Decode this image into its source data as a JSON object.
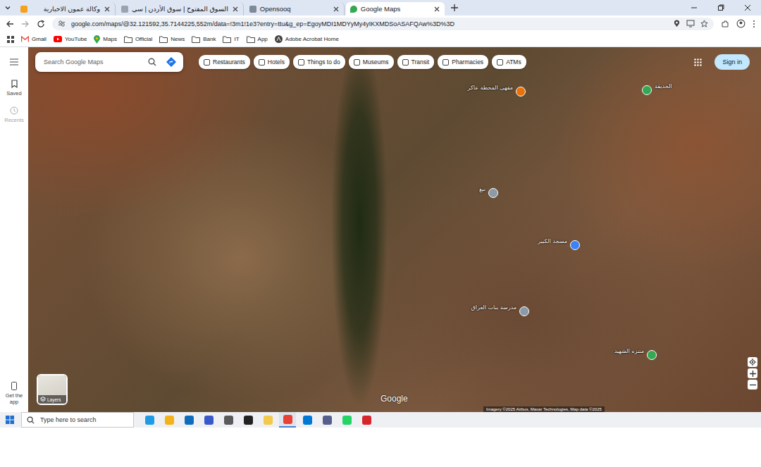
{
  "browser": {
    "tabs": [
      {
        "label": "وكالة عمون الاخبارية",
        "selected": false
      },
      {
        "label": "السوق المفتوح | سوق الأردن | سي",
        "selected": false
      },
      {
        "label": "Opensooq",
        "selected": false
      },
      {
        "label": "Google Maps",
        "selected": true
      }
    ],
    "url": "google.com/maps/@32.121592,35.7144225,552m/data=!3m1!1e3?entry=ttu&g_ep=EgoyMDI1MDYyMy4yIKXMDSoASAFQAw%3D%3D",
    "bookmarks": [
      {
        "label": "Gmail",
        "kind": "gmail"
      },
      {
        "label": "YouTube",
        "kind": "youtube"
      },
      {
        "label": "Maps",
        "kind": "maps"
      },
      {
        "label": "Official",
        "kind": "folder"
      },
      {
        "label": "News",
        "kind": "folder"
      },
      {
        "label": "Bank",
        "kind": "folder"
      },
      {
        "label": "IT",
        "kind": "folder"
      },
      {
        "label": "App",
        "kind": "folder"
      },
      {
        "label": "Adobe Acrobat Home",
        "kind": "adobe"
      }
    ]
  },
  "maps": {
    "rail": [
      {
        "label": "Saved",
        "disabled": false
      },
      {
        "label": "Recents",
        "disabled": true
      }
    ],
    "get_app": "Get the app",
    "search": {
      "placeholder": "Search Google Maps"
    },
    "chips": [
      "Restaurants",
      "Hotels",
      "Things to do",
      "Museums",
      "Transit",
      "Pharmacies",
      "ATMs"
    ],
    "sign_in": "Sign in",
    "layers": "Layers",
    "logo": "Google",
    "attribution": "Imagery ©2025 Airbus, Maxar Technologies, Map data ©2025",
    "markers": [
      {
        "label": "مقهى المحطة عاكر",
        "color": "#e8710a"
      },
      {
        "label": "نبع",
        "color": "#8a9aa8"
      },
      {
        "label": "مسجد الكبير",
        "color": "#3b82f6"
      },
      {
        "label": "مدرسة بنات العراق",
        "color": "#8a9aa8"
      },
      {
        "label": "متنزه الشهيد",
        "color": "#34a853"
      },
      {
        "label": "الحديقة",
        "color": "#34a853"
      }
    ]
  },
  "taskbar": {
    "search_placeholder": "Type here to search",
    "apps": [
      {
        "active": false
      },
      {
        "active": false
      },
      {
        "active": false
      },
      {
        "active": false
      },
      {
        "active": false
      },
      {
        "active": false
      },
      {
        "active": false
      },
      {
        "active": true
      },
      {
        "active": false
      },
      {
        "active": false
      },
      {
        "active": false
      },
      {
        "active": false
      }
    ]
  }
}
